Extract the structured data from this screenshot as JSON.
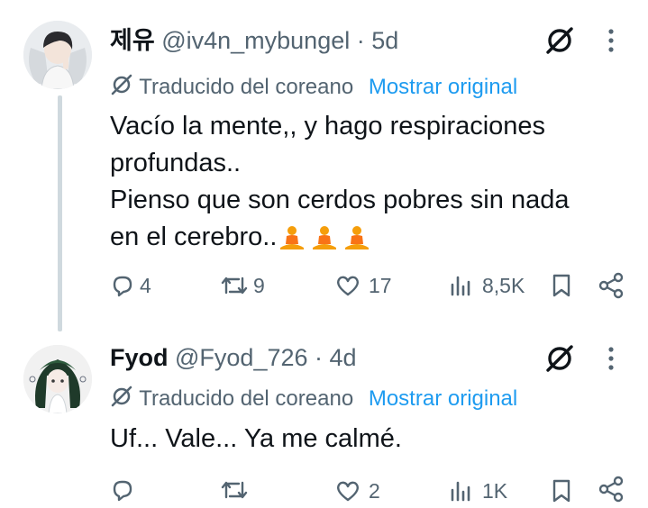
{
  "tweets": [
    {
      "name": "제유",
      "handle_time": "@iv4n_mybungel · 5d",
      "translated_label": "Traducido del coreano",
      "show_original": "Mostrar original",
      "lines": [
        "Vacío la mente,, y hago respiraciones",
        "profundas..",
        "Pienso que son cerdos pobres sin nada",
        "en el cerebro.."
      ],
      "emoji": "🧘🧘🧘",
      "replies": "4",
      "reposts": "9",
      "likes": "17",
      "views": "8,5K"
    },
    {
      "name": "Fyod",
      "handle_time": "@Fyod_726 · 4d",
      "translated_label": "Traducido del coreano",
      "show_original": "Mostrar original",
      "lines": [
        "Uf... Vale... Ya me calmé."
      ],
      "replies": "",
      "reposts": "",
      "likes": "2",
      "views": "1K"
    }
  ],
  "colors": {
    "text": "#0f1419",
    "muted": "#536471",
    "link": "#1d9bf0",
    "line": "#cfd9de",
    "emoji": "#f59e0b"
  },
  "icons": [
    "grok-icon",
    "more-icon",
    "translate-icon",
    "reply-icon",
    "repost-icon",
    "like-icon",
    "views-icon",
    "bookmark-icon",
    "share-icon"
  ]
}
